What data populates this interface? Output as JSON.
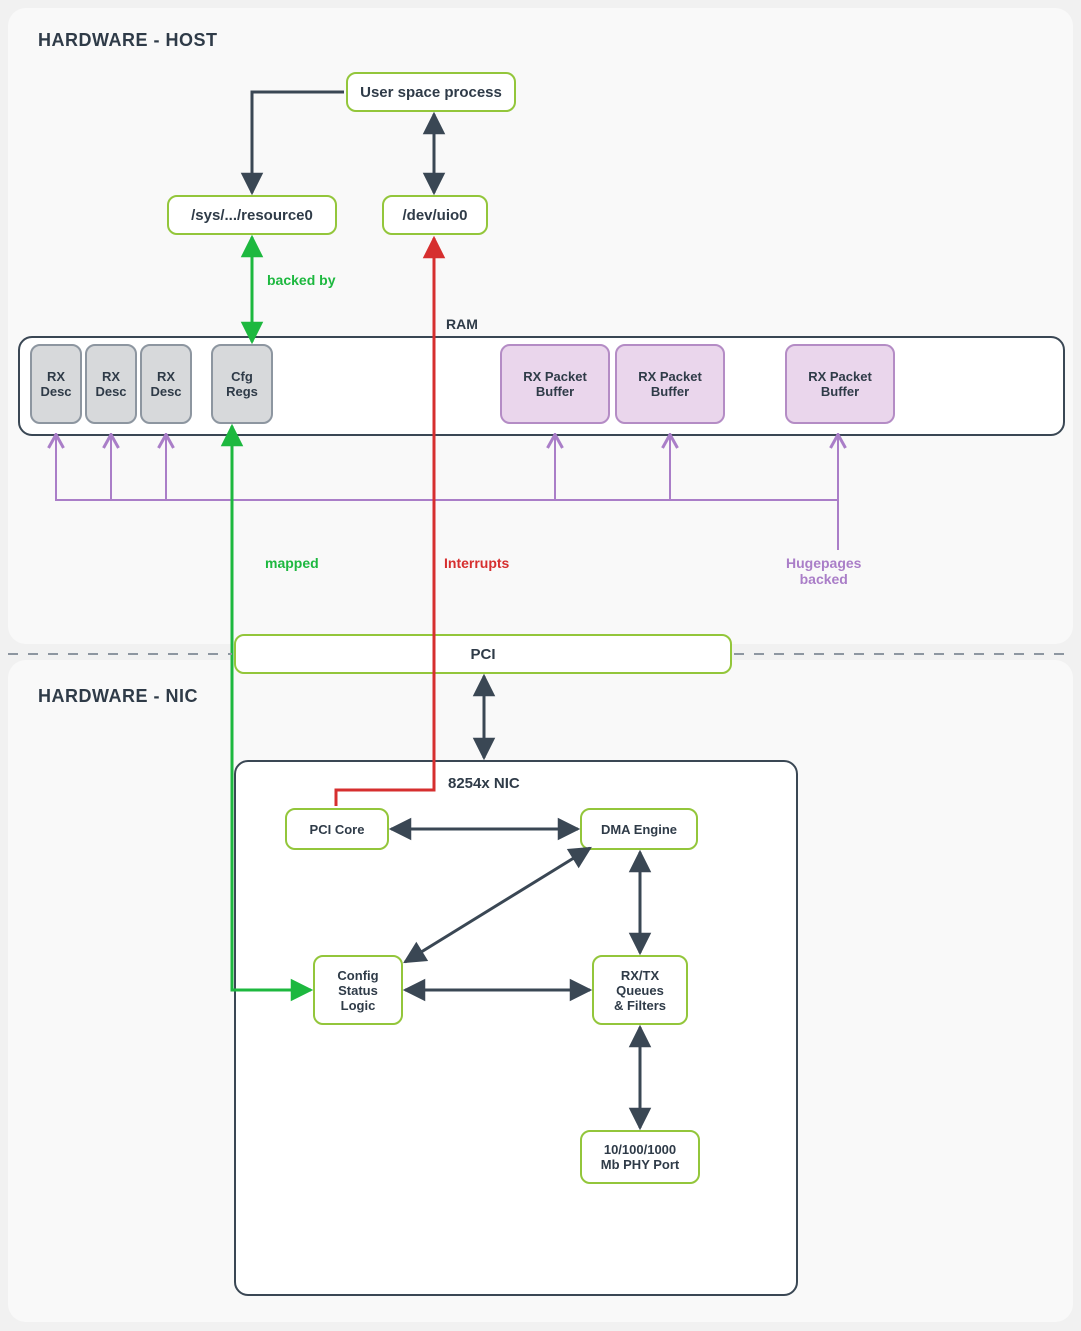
{
  "sections": {
    "host_title": "HARDWARE - HOST",
    "nic_title": "HARDWARE - NIC"
  },
  "nodes": {
    "user_space": "User space process",
    "sys_resource": "/sys/.../resource0",
    "dev_uio": "/dev/uio0",
    "pci": "PCI",
    "nic_label": "8254x NIC",
    "pci_core": "PCI Core",
    "dma_engine": "DMA Engine",
    "config_status": "Config\nStatus\nLogic",
    "rxtx_queues": "RX/TX\nQueues\n& Filters",
    "phy_port": "10/100/1000\nMb PHY Port"
  },
  "ram": {
    "label": "RAM",
    "rx_desc": "RX\nDesc",
    "cfg_regs": "Cfg\nRegs",
    "rx_buf": "RX Packet\nBuffer"
  },
  "labels": {
    "backed_by": "backed by",
    "mapped": "mapped",
    "interrupts": "Interrupts",
    "hugepages": "Hugepages\nbacked"
  },
  "colors": {
    "green_stroke": "#1db83f",
    "red_stroke": "#d62f2f",
    "purple_stroke": "#aa7ec8",
    "dark_stroke": "#3a4754",
    "lime_stroke": "#93c63b"
  }
}
